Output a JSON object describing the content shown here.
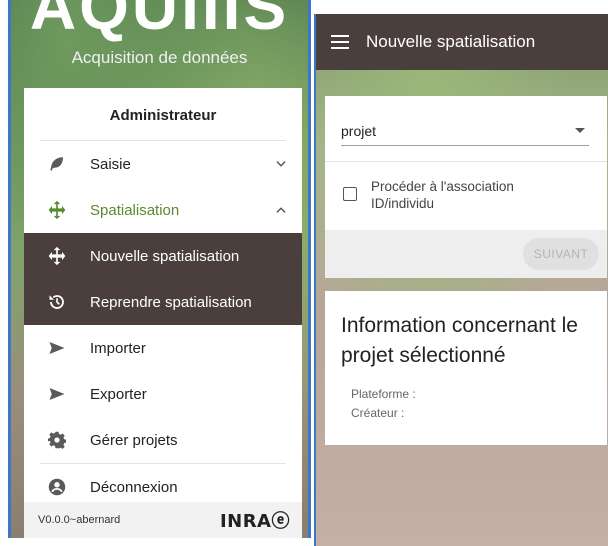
{
  "left": {
    "logo_text": "AQUIIIS",
    "logo_subtitle": "Acquisition de données",
    "user_role": "Administrateur",
    "menu": [
      {
        "label": "Saisie",
        "icon": "leaf-icon",
        "chevron": "chevron-down"
      },
      {
        "label": "Spatialisation",
        "icon": "move-icon",
        "chevron": "chevron-up",
        "active": true
      },
      {
        "label": "Nouvelle spatialisation",
        "icon": "move-icon",
        "submenu": true
      },
      {
        "label": "Reprendre spatialisation",
        "icon": "history-icon",
        "submenu": true
      },
      {
        "label": "Importer",
        "icon": "send-icon"
      },
      {
        "label": "Exporter",
        "icon": "send-icon"
      },
      {
        "label": "Gérer projets",
        "icon": "gear-icon"
      },
      {
        "label": "Déconnexion",
        "icon": "account-icon"
      }
    ],
    "version": "V0.0.0~abernard",
    "brand": "INRAⓔ",
    "colors": {
      "accent_green": "#5a8a2e",
      "dark_bar": "#4a3f3c"
    }
  },
  "right": {
    "app_title": "Nouvelle spatialisation",
    "project_select": {
      "value": "projet"
    },
    "checkbox_label": "Procéder à l'association ID/individu",
    "checkbox_checked": false,
    "next_button": "SUIVANT",
    "info_title": "Information concernant le projet sélectionné",
    "fields": {
      "platform_label": "Plateforme :",
      "creator_label": "Créateur :"
    }
  }
}
